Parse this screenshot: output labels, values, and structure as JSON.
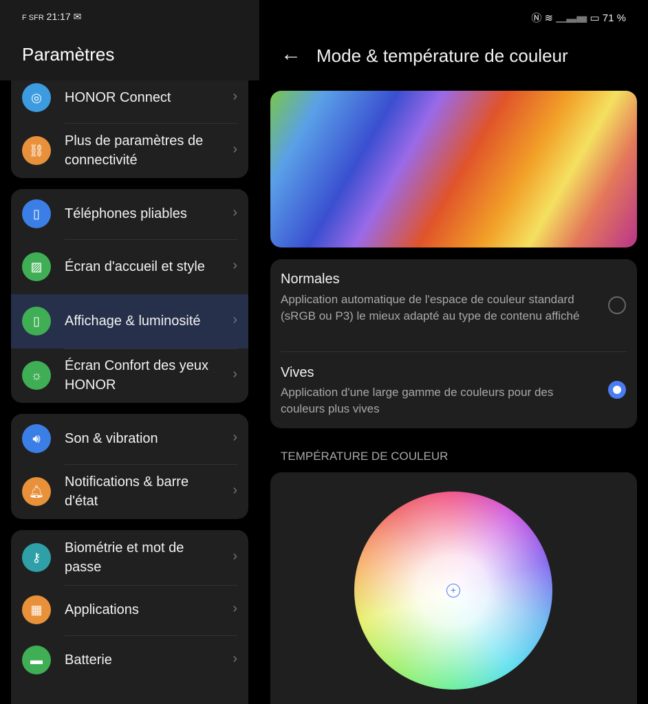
{
  "status_left": {
    "carrier": "F SFR",
    "time": "21:17",
    "mail_icon": "gmail-icon"
  },
  "status_right": {
    "icons": [
      "nfc-icon",
      "wifi-icon",
      "signal-icon",
      "battery-icon"
    ],
    "battery": "71 %"
  },
  "left": {
    "title": "Paramètres",
    "groups": [
      [
        {
          "label": "HONOR Connect",
          "icon": "honor-connect-icon",
          "color": "#3d9be0"
        },
        {
          "label": "Plus de paramètres de connectivité",
          "icon": "link-icon",
          "color": "#e8913a"
        }
      ],
      [
        {
          "label": "Téléphones pliables",
          "icon": "foldable-icon",
          "color": "#3b7fe6"
        },
        {
          "label": "Écran d'accueil et style",
          "icon": "image-icon",
          "color": "#3fae55"
        },
        {
          "label": "Affichage & luminosité",
          "icon": "display-icon",
          "color": "#3fae55",
          "selected": true
        },
        {
          "label": "Écran Confort des yeux HONOR",
          "icon": "eye-comfort-icon",
          "color": "#3fae55"
        }
      ],
      [
        {
          "label": "Son & vibration",
          "icon": "speaker-icon",
          "color": "#3b7fe6"
        },
        {
          "label": "Notifications & barre d'état",
          "icon": "bell-icon",
          "color": "#e8913a"
        }
      ],
      [
        {
          "label": "Biométrie et mot de passe",
          "icon": "key-icon",
          "color": "#2fa0a8"
        },
        {
          "label": "Applications",
          "icon": "apps-icon",
          "color": "#e8913a"
        },
        {
          "label": "Batterie",
          "icon": "battery-icon",
          "color": "#3fae55"
        }
      ]
    ]
  },
  "right": {
    "title": "Mode & température de couleur",
    "back_icon": "back-arrow-icon",
    "modes": [
      {
        "title": "Normales",
        "desc": "Application automatique de l'espace de couleur standard (sRGB ou P3) le mieux adapté au type de contenu affiché",
        "selected": false
      },
      {
        "title": "Vives",
        "desc": "Application d'une large gamme de couleurs pour des couleurs plus vives",
        "selected": true
      }
    ],
    "section": "TEMPÉRATURE DE COULEUR",
    "accent": "#4a7cf2"
  }
}
